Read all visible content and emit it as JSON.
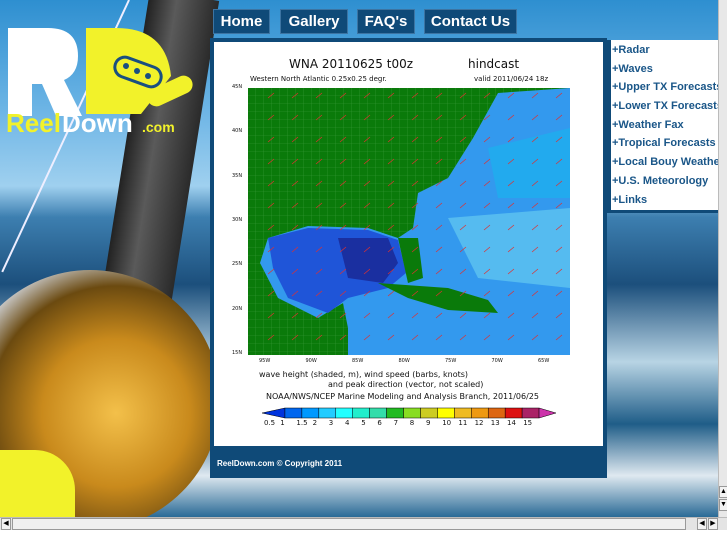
{
  "logo": {
    "text": "ReelDown.com"
  },
  "nav": [
    {
      "label": "Home"
    },
    {
      "label": "Gallery"
    },
    {
      "label": "FAQ's"
    },
    {
      "label": "Contact Us"
    }
  ],
  "chart": {
    "title": "WNA 20110625 t00z",
    "mode": "hindcast",
    "subtitle": "Western North Atlantic 0.25x0.25 degr.",
    "valid": "valid 2011/06/24 18z",
    "lat_ticks": [
      "45N",
      "40N",
      "35N",
      "30N",
      "25N",
      "20N",
      "15N"
    ],
    "lon_ticks": [
      "95W",
      "90W",
      "85W",
      "80W",
      "75W",
      "70W",
      "65W"
    ],
    "caption1": "wave height (shaded, m), wind speed (barbs, knots)",
    "caption2": "and peak direction (vector, not scaled)",
    "credit": "NOAA/NWS/NCEP Marine Modeling and Analysis Branch, 2011/06/25",
    "colorbar_labels": [
      "0.5",
      "1",
      "1.5",
      "2",
      "3",
      "4",
      "5",
      "6",
      "7",
      "8",
      "9",
      "10",
      "11",
      "12",
      "13",
      "14",
      "15"
    ],
    "colorbar_colors": [
      "#0033dd",
      "#0066ee",
      "#0099ff",
      "#22ccff",
      "#22ffff",
      "#22eecc",
      "#33ddaa",
      "#22bb22",
      "#88dd22",
      "#cccc22",
      "#ffff00",
      "#eebb22",
      "#ee9911",
      "#dd6611",
      "#dd1111",
      "#aa2266",
      "#cc33aa"
    ]
  },
  "sidebar": [
    {
      "label": "+Radar"
    },
    {
      "label": "+Waves"
    },
    {
      "label": "+Upper TX Forecasts"
    },
    {
      "label": "+Lower TX Forecasts"
    },
    {
      "label": "+Weather Fax"
    },
    {
      "label": "+Tropical Forecasts"
    },
    {
      "label": "+Local Bouy Weather"
    },
    {
      "label": "+U.S. Meteorology"
    },
    {
      "label": "+Links"
    }
  ],
  "footer": "ReelDown.com © Copyright 2011",
  "colors": {
    "brand_blue": "#0f4a78",
    "logo_yellow": "#f2f22a"
  }
}
